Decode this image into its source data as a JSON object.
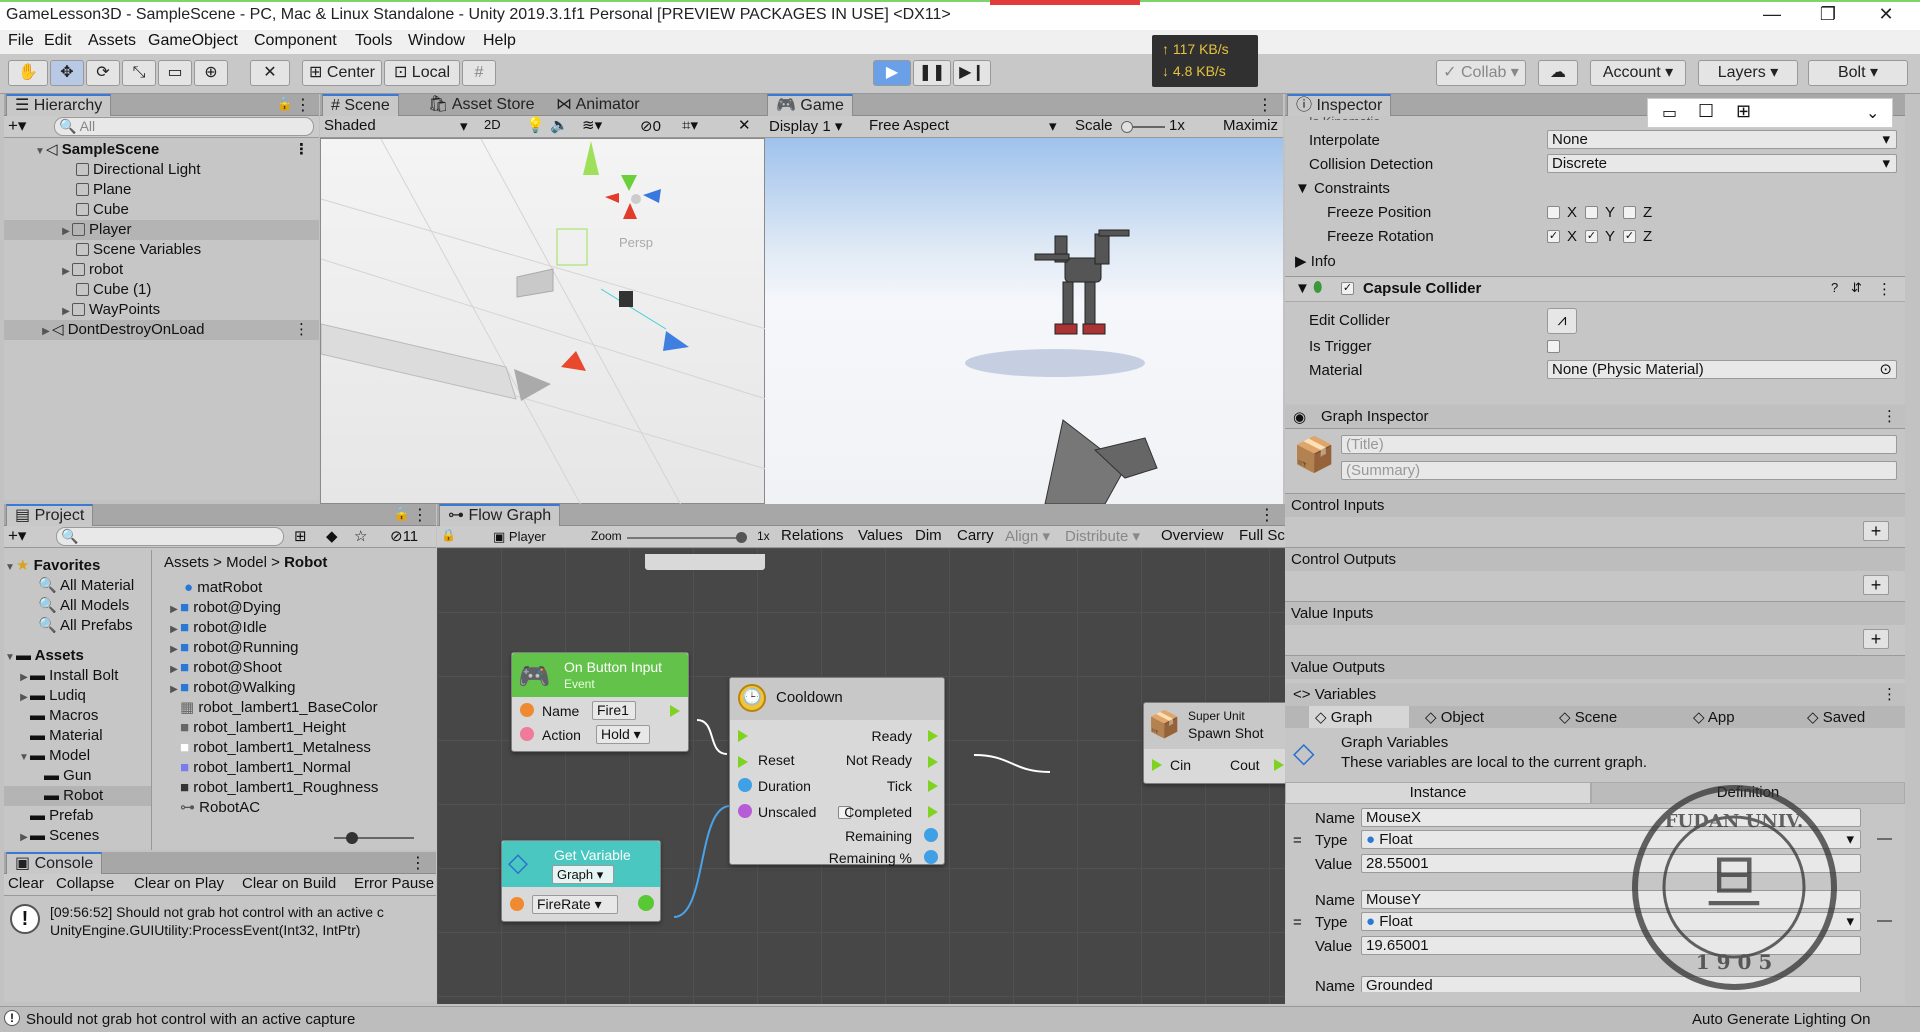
{
  "window": {
    "title": "GameLesson3D - SampleScene - PC, Mac & Linux Standalone - Unity 2019.3.1f1 Personal [PREVIEW PACKAGES IN USE] <DX11>",
    "controls": [
      "—",
      "❐",
      "✕"
    ]
  },
  "menu": [
    "File",
    "Edit",
    "Assets",
    "GameObject",
    "Component",
    "Tools",
    "Window",
    "Help"
  ],
  "toolbar": {
    "pivot": "Center",
    "space": "Local",
    "collab": "Collab",
    "account": "Account",
    "layers": "Layers",
    "layout": "Bolt",
    "net_up": "↑ 117 KB/s",
    "net_down": "↓ 4.8 KB/s"
  },
  "hierarchy": {
    "tab": "Hierarchy",
    "search_placeholder": "All",
    "scene": "SampleScene",
    "items": [
      "Directional Light",
      "Plane",
      "Cube",
      "Player",
      "Scene Variables",
      "robot",
      "Cube (1)",
      "WayPoints"
    ],
    "ddol": "DontDestroyOnLoad"
  },
  "scene_view": {
    "tabs": [
      "Scene",
      "Asset Store",
      "Animator"
    ],
    "shading": "Shaded",
    "mode2d": "2D",
    "hidden_count": "0",
    "persp": "Persp"
  },
  "game_view": {
    "tab": "Game",
    "display": "Display 1",
    "aspect": "Free Aspect",
    "scale_label": "Scale",
    "scale_value": "1x",
    "maximize": "Maximiz",
    "scale_fraction": 0.05
  },
  "project": {
    "tab": "Project",
    "hidden_count": "11",
    "favorites_label": "Favorites",
    "favorites": [
      "All Material",
      "All Models",
      "All Prefabs"
    ],
    "assets_label": "Assets",
    "folders": [
      "Install Bolt",
      "Ludiq",
      "Macros",
      "Material",
      "Model",
      "Gun",
      "Robot",
      "Prefab",
      "Scenes"
    ],
    "breadcrumb": [
      "Assets",
      "Model",
      "Robot"
    ],
    "files": [
      "matRobot",
      "robot@Dying",
      "robot@Idle",
      "robot@Running",
      "robot@Shoot",
      "robot@Walking",
      "robot_lambert1_BaseColor",
      "robot_lambert1_Height",
      "robot_lambert1_Metalness",
      "robot_lambert1_Normal",
      "robot_lambert1_Roughness",
      "RobotAC"
    ]
  },
  "console": {
    "tab": "Console",
    "buttons": [
      "Clear",
      "Collapse",
      "Clear on Play",
      "Clear on Build",
      "Error Pause"
    ],
    "message_line1": "[09:56:52] Should not grab hot control with an active c",
    "message_line2": "UnityEngine.GUIUtility:ProcessEvent(Int32, IntPtr)"
  },
  "flow_graph": {
    "tab": "Flow Graph",
    "context": "Player",
    "zoom_label": "Zoom",
    "zoom_value": "1x",
    "zoom_fraction": 0.97,
    "toolbar": [
      "Relations",
      "Values",
      "Dim",
      "Carry",
      "Align",
      "Distribute",
      "Overview",
      "Full Sc"
    ],
    "nodes": {
      "button_input": {
        "title": "On Button Input",
        "sub": "Event",
        "name_label": "Name",
        "name_value": "Fire1",
        "action_label": "Action",
        "action_value": "Hold"
      },
      "get_variable": {
        "title": "Get Variable",
        "kind": "Graph",
        "var": "FireRate"
      },
      "cooldown": {
        "title": "Cooldown",
        "in_ports": [
          "",
          "Reset",
          "Duration",
          "Unscaled"
        ],
        "out_ports": [
          "Ready",
          "Not Ready",
          "Tick",
          "Completed",
          "Remaining",
          "Remaining %"
        ]
      },
      "super_unit": {
        "title_small": "Super Unit",
        "title": "Spawn Shot",
        "in": "Cin",
        "out": "Cout"
      }
    }
  },
  "inspector": {
    "tab": "Inspector",
    "clipped": "Is Kinematic",
    "interpolate_label": "Interpolate",
    "interpolate_value": "None",
    "collision_label": "Collision Detection",
    "collision_value": "Discrete",
    "constraints_label": "Constraints",
    "freeze_pos_label": "Freeze Position",
    "freeze_rot_label": "Freeze Rotation",
    "axes": [
      "X",
      "Y",
      "Z"
    ],
    "info_label": "Info",
    "capsule_label": "Capsule Collider",
    "edit_collider_label": "Edit Collider",
    "is_trigger_label": "Is Trigger",
    "material_label": "Material",
    "material_value": "None (Physic Material)"
  },
  "graph_inspector": {
    "title": "Graph Inspector",
    "title_placeholder": "(Title)",
    "summary_placeholder": "(Summary)",
    "sections": [
      "Control Inputs",
      "Control Outputs",
      "Value Inputs",
      "Value Outputs"
    ]
  },
  "variables": {
    "tab": "Variables",
    "scopes": [
      "Graph",
      "Object",
      "Scene",
      "App",
      "Saved"
    ],
    "heading": "Graph Variables",
    "desc": "These variables are local to the current graph.",
    "subtabs": [
      "Instance",
      "Definition"
    ],
    "name_label": "Name",
    "type_label": "Type",
    "value_label": "Value",
    "items": [
      {
        "name": "MouseX",
        "type": "Float",
        "value": "28.55001"
      },
      {
        "name": "MouseY",
        "type": "Float",
        "value": "19.65001"
      },
      {
        "name": "Grounded",
        "type": "",
        "value": ""
      }
    ]
  },
  "stamp": {
    "text": "FUDAN UNIVERSITY",
    "year": "1905"
  },
  "status": {
    "message": "Should not grab hot control with an active capture",
    "right": "Auto Generate Lighting On"
  }
}
